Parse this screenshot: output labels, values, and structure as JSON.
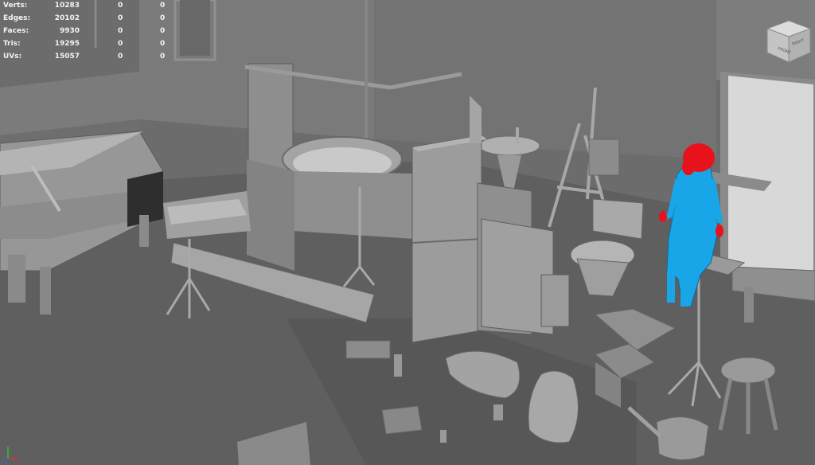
{
  "hud": {
    "rows": [
      {
        "label": "Verts:",
        "total": "10283",
        "selected": "0",
        "components": "0"
      },
      {
        "label": "Edges:",
        "total": "20102",
        "selected": "0",
        "components": "0"
      },
      {
        "label": "Faces:",
        "total": "9930",
        "selected": "0",
        "components": "0"
      },
      {
        "label": "Tris:",
        "total": "19295",
        "selected": "0",
        "components": "0"
      },
      {
        "label": "UVs:",
        "total": "15057",
        "selected": "0",
        "components": "0"
      }
    ]
  },
  "viewcube": {
    "front_label": "FRONT",
    "right_label": "RIGHT"
  },
  "colors": {
    "viewport_bg": "#6a6a6a",
    "geometry": "#8a8a8a",
    "selected_body": "#19a6e8",
    "selected_head": "#e8121c",
    "hud_text": "#f2f2f2"
  },
  "icons": [
    "view-cube-icon",
    "axis-gizmo-icon"
  ]
}
